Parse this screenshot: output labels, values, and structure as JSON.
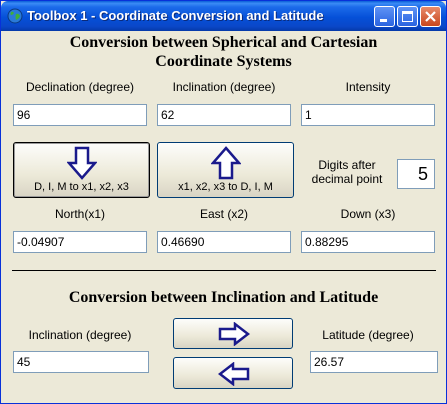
{
  "window": {
    "title": "Toolbox 1 - Coordinate Conversion and Latitude"
  },
  "section1": {
    "title_line1": "Conversion between Spherical and Cartesian",
    "title_line2": "Coordinate Systems",
    "declination_label": "Declination (degree)",
    "declination_value": "96",
    "inclination_label": "Inclination (degree)",
    "inclination_value": "62",
    "intensity_label": "Intensity",
    "intensity_value": "1",
    "to_cartesian_button": "D, I, M to x1, x2, x3",
    "to_spherical_button": "x1, x2, x3 to D, I, M",
    "digits_label_line1": "Digits after",
    "digits_label_line2": "decimal point",
    "digits_value": "5",
    "north_label": "North(x1)",
    "north_value": "-0.04907",
    "east_label": "East (x2)",
    "east_value": "0.46690",
    "down_label": "Down (x3)",
    "down_value": "0.88295"
  },
  "section2": {
    "title": "Conversion between Inclination and Latitude",
    "inclination_label": "Inclination (degree)",
    "inclination_value": "45",
    "latitude_label": "Latitude (degree)",
    "latitude_value": "26.57"
  },
  "icons": {
    "app": "globe-icon",
    "down_arrow": "arrow-down-icon",
    "up_arrow": "arrow-up-icon",
    "right_arrow": "arrow-right-icon",
    "left_arrow": "arrow-left-icon"
  },
  "colors": {
    "title_bar": "#0550d8",
    "arrow_fill": "#ffffff",
    "arrow_outline": "#1a1a8c",
    "window_bg": "#ece9d8"
  }
}
